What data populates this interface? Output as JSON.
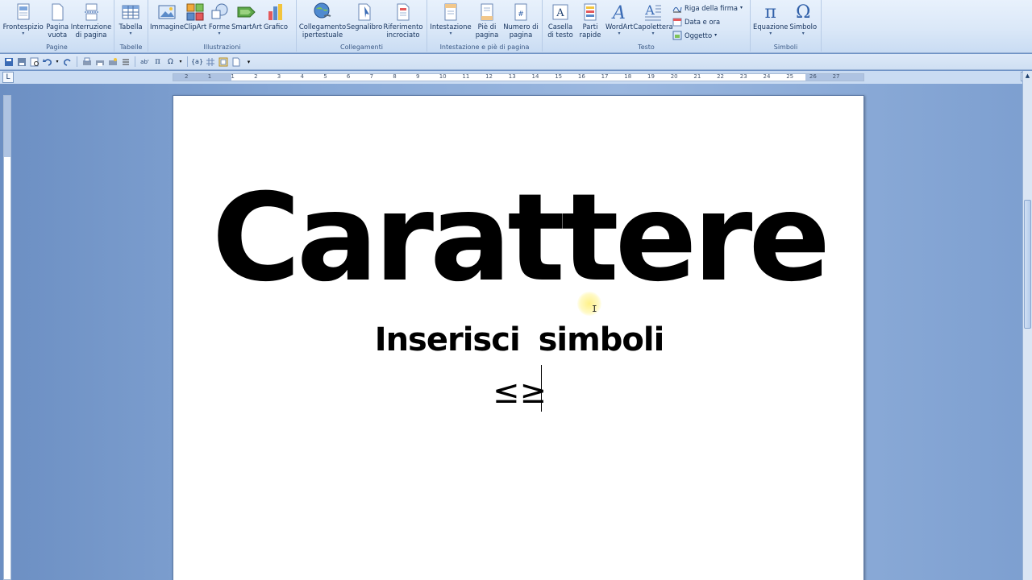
{
  "ribbon": {
    "groups": [
      {
        "label": "Pagine",
        "buttons": [
          {
            "label": "Frontespizio",
            "dropdown": true,
            "icon": "cover-page-icon"
          },
          {
            "label": "Pagina\nvuota",
            "dropdown": false,
            "icon": "blank-page-icon"
          },
          {
            "label": "Interruzione\ndi pagina",
            "dropdown": false,
            "icon": "page-break-icon"
          }
        ]
      },
      {
        "label": "Tabelle",
        "buttons": [
          {
            "label": "Tabella",
            "dropdown": true,
            "icon": "table-icon"
          }
        ]
      },
      {
        "label": "Illustrazioni",
        "buttons": [
          {
            "label": "Immagine",
            "dropdown": false,
            "icon": "picture-icon"
          },
          {
            "label": "ClipArt",
            "dropdown": false,
            "icon": "clipart-icon"
          },
          {
            "label": "Forme",
            "dropdown": true,
            "icon": "shapes-icon"
          },
          {
            "label": "SmartArt",
            "dropdown": false,
            "icon": "smartart-icon"
          },
          {
            "label": "Grafico",
            "dropdown": false,
            "icon": "chart-icon"
          }
        ]
      },
      {
        "label": "Collegamenti",
        "buttons": [
          {
            "label": "Collegamento\nipertestuale",
            "dropdown": false,
            "icon": "hyperlink-icon"
          },
          {
            "label": "Segnalibro",
            "dropdown": false,
            "icon": "bookmark-icon"
          },
          {
            "label": "Riferimento\nincrociato",
            "dropdown": false,
            "icon": "cross-reference-icon"
          }
        ]
      },
      {
        "label": "Intestazione e piè di pagina",
        "buttons": [
          {
            "label": "Intestazione",
            "dropdown": true,
            "icon": "header-icon"
          },
          {
            "label": "Piè di\npagina",
            "dropdown": true,
            "icon": "footer-icon"
          },
          {
            "label": "Numero di\npagina",
            "dropdown": true,
            "icon": "page-number-icon"
          }
        ]
      },
      {
        "label": "Testo",
        "buttons": [
          {
            "label": "Casella\ndi testo",
            "dropdown": true,
            "icon": "text-box-icon"
          },
          {
            "label": "Parti\nrapide",
            "dropdown": true,
            "icon": "quick-parts-icon"
          },
          {
            "label": "WordArt",
            "dropdown": true,
            "icon": "wordart-icon"
          },
          {
            "label": "Capolettera",
            "dropdown": true,
            "icon": "drop-cap-icon"
          }
        ],
        "small": [
          {
            "label": "Riga della firma",
            "dropdown": true,
            "icon": "signature-line-icon"
          },
          {
            "label": "Data e ora",
            "dropdown": false,
            "icon": "date-time-icon"
          },
          {
            "label": "Oggetto",
            "dropdown": true,
            "icon": "object-icon"
          }
        ]
      },
      {
        "label": "Simboli",
        "buttons": [
          {
            "label": "Equazione",
            "dropdown": true,
            "icon": "equation-icon",
            "glyph": "π"
          },
          {
            "label": "Simbolo",
            "dropdown": true,
            "icon": "symbol-icon",
            "glyph": "Ω"
          }
        ]
      }
    ]
  },
  "ruler": {
    "tab_selector": "L",
    "numbers": [
      "2",
      "1",
      "1",
      "2",
      "3",
      "4",
      "5",
      "6",
      "7",
      "8",
      "9",
      "10",
      "11",
      "12",
      "13",
      "14",
      "15",
      "16",
      "17",
      "18",
      "19",
      "20",
      "21",
      "22",
      "23",
      "24",
      "25",
      "26",
      "27"
    ]
  },
  "document": {
    "title": "Carattere",
    "subtitle": "Inserisci  simboli",
    "symbols": "≤≥"
  },
  "colors": {
    "ribbon_bg": "#dbe8f8",
    "workspace_bg": "#87a8d6",
    "page_bg": "#ffffff",
    "text": "#000000",
    "cursor_highlight": "#fff08a"
  }
}
